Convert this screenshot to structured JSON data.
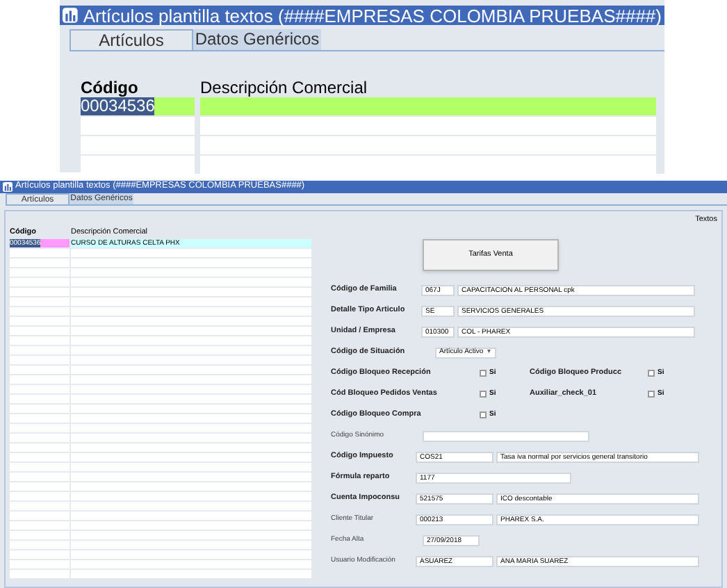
{
  "zoom_view": {
    "title": "Artículos plantilla textos (####EMPRESAS COLOMBIA PRUEBAS####)",
    "tabs": [
      {
        "label": "Artículos",
        "selected": true
      },
      {
        "label": "Datos Genéricos",
        "selected": false
      }
    ],
    "columns": [
      "Código",
      "Descripción Comercial"
    ],
    "rows": [
      {
        "cells": [
          {
            "text": "00034536",
            "color": "#b3ff66",
            "text_selected": true
          },
          {
            "color": "#b3ff66"
          }
        ]
      }
    ]
  },
  "window": {
    "title": "Artículos plantilla textos (####EMPRESAS COLOMBIA PRUEBAS####)",
    "tabs": [
      {
        "label": "Artículos",
        "selected": true
      },
      {
        "label": "Datos Genéricos",
        "selected": false
      }
    ],
    "side_label": "Textos",
    "columns": [
      "Código",
      "Descripción Comercial"
    ],
    "rows": [
      {
        "cells": [
          {
            "text": "00034536",
            "color": "#ff99ff",
            "text_selected": true
          },
          {
            "text": "CURSO DE ALTURAS CELTA PHX",
            "color": "#ccffff",
            "text_selected": false
          }
        ]
      }
    ],
    "button": "Tarifas Venta",
    "form": [
      {
        "kind": "pair",
        "label": "Código de Familia",
        "bold": true,
        "code": "067J",
        "description": "CAPACITACION AL PERSONAL cpk"
      },
      {
        "kind": "pair",
        "label": "Detalle Tipo Articulo",
        "bold": true,
        "code": "SE",
        "description": "SERVICIOS GENERALES"
      },
      {
        "kind": "pair",
        "label": "Unidad / Empresa",
        "bold": true,
        "code": "010300",
        "description": "COL - PHAREX"
      },
      {
        "kind": "select",
        "label": "Código de Situación",
        "bold": true,
        "value": "Artículo Activo",
        "arrow": "▾"
      },
      {
        "kind": "checks",
        "items": [
          {
            "label": "Código Bloqueo Recepción",
            "checked": false,
            "option": "Si"
          },
          {
            "label": "Código Bloqueo Producc",
            "checked": false,
            "option": "Si"
          }
        ]
      },
      {
        "kind": "checks",
        "items": [
          {
            "label": "Cód Bloqueo Pedidos Ventas",
            "checked": false,
            "option": "Si"
          },
          {
            "label": "Auxiliar_check_01",
            "checked": false,
            "option": "Si"
          }
        ]
      },
      {
        "kind": "checks",
        "items": [
          {
            "label": "Código Bloqueo Compra",
            "checked": false,
            "option": "Si"
          }
        ]
      },
      {
        "kind": "single",
        "label": "Código Sinónimo",
        "bold": false
      },
      {
        "kind": "pair_long",
        "label": "Código Impuesto",
        "bold": true,
        "code": "COS21",
        "description": "Tasa iva normal por servicios general transitorio"
      },
      {
        "kind": "single",
        "label": "Fórmula reparto",
        "bold": true,
        "value": "1177"
      },
      {
        "kind": "pair_long",
        "label": "Cuenta Impoconsu",
        "bold": true,
        "code": "521575",
        "description": "ICO descontable"
      },
      {
        "kind": "pair_long",
        "label": "Cliente Titular",
        "bold": false,
        "code": "000213",
        "description": "PHAREX S.A."
      },
      {
        "kind": "date",
        "label": "Fecha Alta",
        "bold": false,
        "value": "27/09/2018"
      },
      {
        "kind": "pair_long",
        "label": "Usuario Modificación",
        "bold": false,
        "code": "ASUAREZ",
        "description": "ANA MARIA SUAREZ"
      }
    ]
  }
}
